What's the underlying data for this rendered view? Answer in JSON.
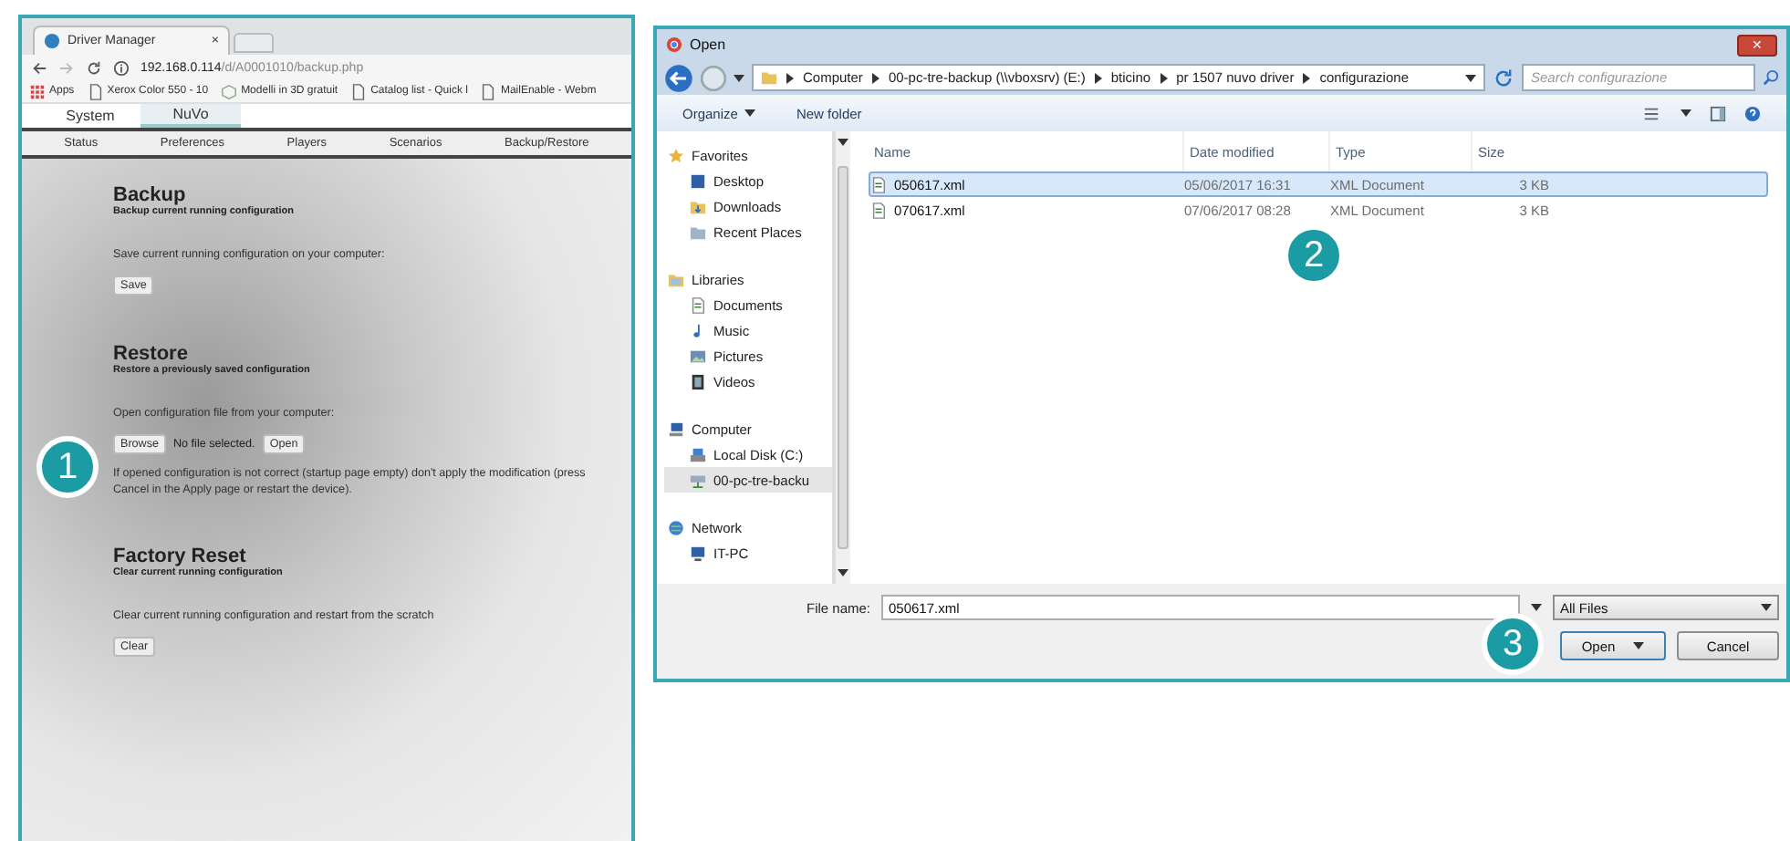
{
  "browser": {
    "tab_title": "Driver Manager",
    "tab_close": "×",
    "url_host": "192.168.0.114",
    "url_path": "/d/A0001010/backup.php",
    "bookmarks": [
      {
        "kind": "apps",
        "label": "Apps"
      },
      {
        "kind": "page",
        "label": "Xerox Color 550 - 10"
      },
      {
        "kind": "model",
        "label": "Modelli in 3D gratuit"
      },
      {
        "kind": "page",
        "label": "Catalog list - Quick l"
      },
      {
        "kind": "page",
        "label": "MailEnable - Webm"
      }
    ],
    "main_tabs": [
      {
        "label": "System",
        "selected": false
      },
      {
        "label": "NuVo",
        "selected": true
      }
    ],
    "sub_tabs": [
      "Status",
      "Preferences",
      "Players",
      "Scenarios",
      "Backup/Restore"
    ],
    "sections": [
      {
        "title": "Backup",
        "subtitle": "Backup current running configuration",
        "text": "Save current running configuration on your computer:",
        "controls": [
          {
            "kind": "button",
            "label": "Save"
          }
        ]
      },
      {
        "title": "Restore",
        "subtitle": "Restore a previously saved configuration",
        "text": "Open configuration file from your computer:",
        "controls": [
          {
            "kind": "button",
            "label": "Browse"
          },
          {
            "kind": "status",
            "label": "No file selected."
          },
          {
            "kind": "button",
            "label": "Open"
          }
        ],
        "note": "If opened configuration is not correct (startup page empty) don't apply the modification (press Cancel in the Apply page or restart the device)."
      },
      {
        "title": "Factory Reset",
        "subtitle": "Clear current running configuration",
        "text": "Clear current running configuration and restart from the scratch",
        "controls": [
          {
            "kind": "button",
            "label": "Clear"
          }
        ]
      }
    ]
  },
  "dialog": {
    "title": "Open",
    "close": "✕",
    "breadcrumbs": [
      "Computer",
      "00-pc-tre-backup (\\\\vboxsrv) (E:)",
      "bticino",
      "pr 1507 nuvo driver",
      "configurazione"
    ],
    "search": {
      "placeholder": "Search configurazione"
    },
    "toolbar": [
      {
        "label": "Organize",
        "dropdown": true
      },
      {
        "label": "New folder",
        "dropdown": false
      }
    ],
    "nav": [
      {
        "kind": "favorites",
        "label": "Favorites",
        "selected": false,
        "children": [
          {
            "kind": "desktop",
            "label": "Desktop",
            "selected": false
          },
          {
            "kind": "downloads",
            "label": "Downloads",
            "selected": false
          },
          {
            "kind": "recent",
            "label": "Recent Places",
            "selected": false
          }
        ]
      },
      {
        "kind": "libraries",
        "label": "Libraries",
        "selected": false,
        "children": [
          {
            "kind": "documents",
            "label": "Documents",
            "selected": false
          },
          {
            "kind": "music",
            "label": "Music",
            "selected": false
          },
          {
            "kind": "pictures",
            "label": "Pictures",
            "selected": false
          },
          {
            "kind": "videos",
            "label": "Videos",
            "selected": false
          }
        ]
      },
      {
        "kind": "computer",
        "label": "Computer",
        "selected": false,
        "children": [
          {
            "kind": "disk",
            "label": "Local Disk (C:)",
            "selected": false
          },
          {
            "kind": "netdrive",
            "label": "00-pc-tre-backu",
            "selected": true
          }
        ]
      },
      {
        "kind": "network",
        "label": "Network",
        "selected": false,
        "children": [
          {
            "kind": "pc",
            "label": "IT-PC",
            "selected": false
          }
        ]
      }
    ],
    "columns": [
      "Name",
      "Date modified",
      "Type",
      "Size"
    ],
    "files": [
      {
        "name": "050617.xml",
        "date": "05/06/2017 16:31",
        "type": "XML Document",
        "size": "3 KB",
        "selected": true
      },
      {
        "name": "070617.xml",
        "date": "07/06/2017 08:28",
        "type": "XML Document",
        "size": "3 KB",
        "selected": false
      }
    ],
    "file_name_label": "File name:",
    "file_name": "050617.xml",
    "filter": "All Files",
    "buttons": [
      "Open",
      "Cancel"
    ]
  },
  "callouts": [
    "1",
    "2",
    "3"
  ]
}
